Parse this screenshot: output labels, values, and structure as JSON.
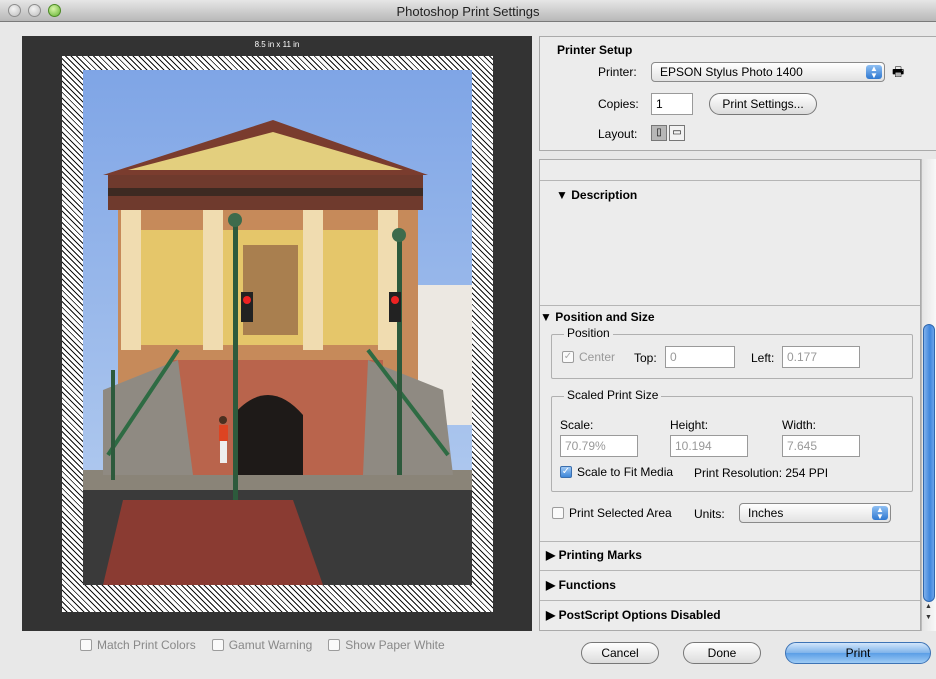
{
  "window": {
    "title": "Photoshop Print Settings"
  },
  "preview": {
    "paper_size": "8.5 in x 11 in"
  },
  "bottom_checks": [
    {
      "label": "Match Print Colors",
      "checked": false
    },
    {
      "label": "Gamut Warning",
      "checked": false
    },
    {
      "label": "Show Paper White",
      "checked": false
    }
  ],
  "printer_setup": {
    "title": "Printer Setup",
    "printer_label": "Printer:",
    "printer_value": "EPSON Stylus Photo 1400",
    "copies_label": "Copies:",
    "copies_value": "1",
    "print_settings_button": "Print Settings...",
    "layout_label": "Layout:"
  },
  "description": {
    "title": "Description",
    "glyph": "▼"
  },
  "position_size": {
    "title": "Position and Size",
    "glyph": "▼",
    "position_group": "Position",
    "center_label": "Center",
    "top_label": "Top:",
    "top_value": "0",
    "left_label": "Left:",
    "left_value": "0.177",
    "scaled_group": "Scaled Print Size",
    "scale_label": "Scale:",
    "scale_value": "70.79%",
    "height_label": "Height:",
    "height_value": "10.194",
    "width_label": "Width:",
    "width_value": "7.645",
    "scale_to_fit_label": "Scale to Fit Media",
    "print_resolution": "Print Resolution: 254 PPI",
    "print_selected_label": "Print Selected Area",
    "units_label": "Units:",
    "units_value": "Inches"
  },
  "collapsed_sections": [
    {
      "title": "Printing Marks",
      "glyph": "▶"
    },
    {
      "title": "Functions",
      "glyph": "▶"
    },
    {
      "title": "PostScript Options Disabled",
      "glyph": "▶"
    }
  ],
  "buttons": {
    "cancel": "Cancel",
    "done": "Done",
    "print": "Print"
  },
  "colors": {
    "accent": "#5b9ee6",
    "preview_bg": "#333333"
  }
}
